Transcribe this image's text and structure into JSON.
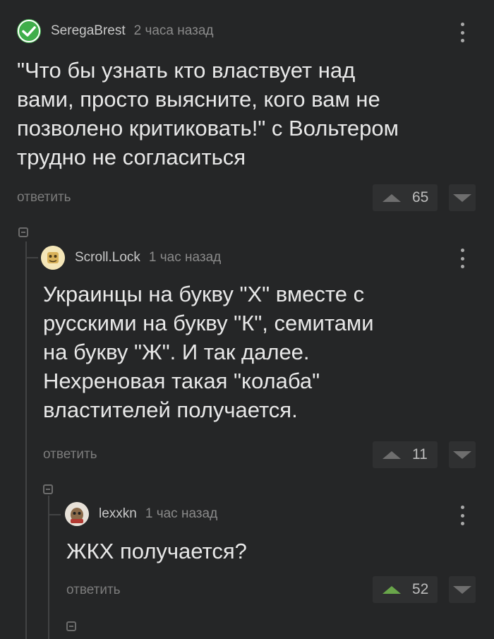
{
  "comments": [
    {
      "author": "SeregaBrest",
      "time": "2 часа назад",
      "body": "\"Что бы узнать кто властвует над\nвами, просто выясните, кого вам не\nпозволено критиковать!\" с Вольтером\nтрудно не согласиться",
      "reply_label": "ответить",
      "score": "65",
      "avatar_icon": "verified-check-icon"
    },
    {
      "author": "Scroll.Lock",
      "time": "1 час назад",
      "body": "Украинцы на букву \"Х\" вместе с\nрусскими на букву \"К\", семитами\nна букву \"Ж\". И так далее.\nНехреновая такая \"колаба\"\nвластителей получается.",
      "reply_label": "ответить",
      "score": "11",
      "avatar_icon": "user-avatar-icon"
    },
    {
      "author": "lexxkn",
      "time": "1 час назад",
      "body": "ЖКХ получается?",
      "reply_label": "ответить",
      "score": "52",
      "avatar_icon": "user-avatar-icon"
    }
  ],
  "colors": {
    "background": "#252627",
    "upvoted": "#69a54a",
    "verified": "#3fae4a"
  }
}
